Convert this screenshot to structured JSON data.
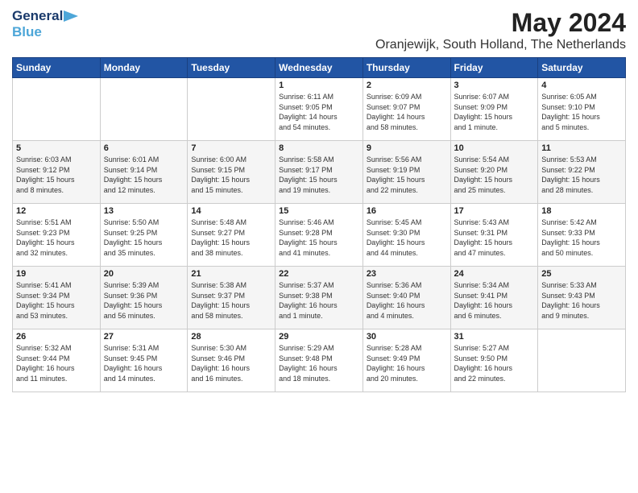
{
  "header": {
    "logo_general": "General",
    "logo_blue": "Blue",
    "month_year": "May 2024",
    "location": "Oranjewijk, South Holland, The Netherlands"
  },
  "calendar": {
    "headers": [
      "Sunday",
      "Monday",
      "Tuesday",
      "Wednesday",
      "Thursday",
      "Friday",
      "Saturday"
    ],
    "weeks": [
      {
        "days": [
          {
            "num": "",
            "info": ""
          },
          {
            "num": "",
            "info": ""
          },
          {
            "num": "",
            "info": ""
          },
          {
            "num": "1",
            "info": "Sunrise: 6:11 AM\nSunset: 9:05 PM\nDaylight: 14 hours\nand 54 minutes."
          },
          {
            "num": "2",
            "info": "Sunrise: 6:09 AM\nSunset: 9:07 PM\nDaylight: 14 hours\nand 58 minutes."
          },
          {
            "num": "3",
            "info": "Sunrise: 6:07 AM\nSunset: 9:09 PM\nDaylight: 15 hours\nand 1 minute."
          },
          {
            "num": "4",
            "info": "Sunrise: 6:05 AM\nSunset: 9:10 PM\nDaylight: 15 hours\nand 5 minutes."
          }
        ]
      },
      {
        "days": [
          {
            "num": "5",
            "info": "Sunrise: 6:03 AM\nSunset: 9:12 PM\nDaylight: 15 hours\nand 8 minutes."
          },
          {
            "num": "6",
            "info": "Sunrise: 6:01 AM\nSunset: 9:14 PM\nDaylight: 15 hours\nand 12 minutes."
          },
          {
            "num": "7",
            "info": "Sunrise: 6:00 AM\nSunset: 9:15 PM\nDaylight: 15 hours\nand 15 minutes."
          },
          {
            "num": "8",
            "info": "Sunrise: 5:58 AM\nSunset: 9:17 PM\nDaylight: 15 hours\nand 19 minutes."
          },
          {
            "num": "9",
            "info": "Sunrise: 5:56 AM\nSunset: 9:19 PM\nDaylight: 15 hours\nand 22 minutes."
          },
          {
            "num": "10",
            "info": "Sunrise: 5:54 AM\nSunset: 9:20 PM\nDaylight: 15 hours\nand 25 minutes."
          },
          {
            "num": "11",
            "info": "Sunrise: 5:53 AM\nSunset: 9:22 PM\nDaylight: 15 hours\nand 28 minutes."
          }
        ]
      },
      {
        "days": [
          {
            "num": "12",
            "info": "Sunrise: 5:51 AM\nSunset: 9:23 PM\nDaylight: 15 hours\nand 32 minutes."
          },
          {
            "num": "13",
            "info": "Sunrise: 5:50 AM\nSunset: 9:25 PM\nDaylight: 15 hours\nand 35 minutes."
          },
          {
            "num": "14",
            "info": "Sunrise: 5:48 AM\nSunset: 9:27 PM\nDaylight: 15 hours\nand 38 minutes."
          },
          {
            "num": "15",
            "info": "Sunrise: 5:46 AM\nSunset: 9:28 PM\nDaylight: 15 hours\nand 41 minutes."
          },
          {
            "num": "16",
            "info": "Sunrise: 5:45 AM\nSunset: 9:30 PM\nDaylight: 15 hours\nand 44 minutes."
          },
          {
            "num": "17",
            "info": "Sunrise: 5:43 AM\nSunset: 9:31 PM\nDaylight: 15 hours\nand 47 minutes."
          },
          {
            "num": "18",
            "info": "Sunrise: 5:42 AM\nSunset: 9:33 PM\nDaylight: 15 hours\nand 50 minutes."
          }
        ]
      },
      {
        "days": [
          {
            "num": "19",
            "info": "Sunrise: 5:41 AM\nSunset: 9:34 PM\nDaylight: 15 hours\nand 53 minutes."
          },
          {
            "num": "20",
            "info": "Sunrise: 5:39 AM\nSunset: 9:36 PM\nDaylight: 15 hours\nand 56 minutes."
          },
          {
            "num": "21",
            "info": "Sunrise: 5:38 AM\nSunset: 9:37 PM\nDaylight: 15 hours\nand 58 minutes."
          },
          {
            "num": "22",
            "info": "Sunrise: 5:37 AM\nSunset: 9:38 PM\nDaylight: 16 hours\nand 1 minute."
          },
          {
            "num": "23",
            "info": "Sunrise: 5:36 AM\nSunset: 9:40 PM\nDaylight: 16 hours\nand 4 minutes."
          },
          {
            "num": "24",
            "info": "Sunrise: 5:34 AM\nSunset: 9:41 PM\nDaylight: 16 hours\nand 6 minutes."
          },
          {
            "num": "25",
            "info": "Sunrise: 5:33 AM\nSunset: 9:43 PM\nDaylight: 16 hours\nand 9 minutes."
          }
        ]
      },
      {
        "days": [
          {
            "num": "26",
            "info": "Sunrise: 5:32 AM\nSunset: 9:44 PM\nDaylight: 16 hours\nand 11 minutes."
          },
          {
            "num": "27",
            "info": "Sunrise: 5:31 AM\nSunset: 9:45 PM\nDaylight: 16 hours\nand 14 minutes."
          },
          {
            "num": "28",
            "info": "Sunrise: 5:30 AM\nSunset: 9:46 PM\nDaylight: 16 hours\nand 16 minutes."
          },
          {
            "num": "29",
            "info": "Sunrise: 5:29 AM\nSunset: 9:48 PM\nDaylight: 16 hours\nand 18 minutes."
          },
          {
            "num": "30",
            "info": "Sunrise: 5:28 AM\nSunset: 9:49 PM\nDaylight: 16 hours\nand 20 minutes."
          },
          {
            "num": "31",
            "info": "Sunrise: 5:27 AM\nSunset: 9:50 PM\nDaylight: 16 hours\nand 22 minutes."
          },
          {
            "num": "",
            "info": ""
          }
        ]
      }
    ]
  }
}
